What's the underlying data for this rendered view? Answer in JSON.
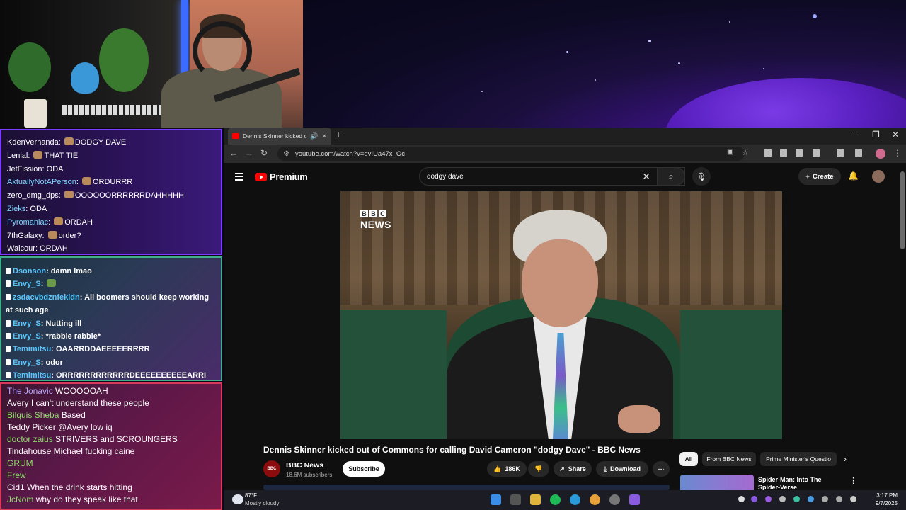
{
  "chat_top": [
    {
      "user": "KdenVernanda",
      "color": "#ffffff",
      "msg": "DODGY DAVE",
      "emote": true
    },
    {
      "user": "Lenial",
      "color": "#ffffff",
      "msg": "THAT TIE",
      "emote": true
    },
    {
      "user": "JetFission",
      "color": "#ffffff",
      "msg": "ODA",
      "emote": false
    },
    {
      "user": "AktuallyNotAPerson",
      "color": "#7fd3ff",
      "msg": "ORDURRR",
      "emote": true
    },
    {
      "user": "zero_dmg_dps",
      "color": "#ffffff",
      "msg": "OOOOOORRRRRRDAHHHHH",
      "emote": true
    },
    {
      "user": "Zieks",
      "color": "#7fd3ff",
      "msg": "ODA",
      "emote": false
    },
    {
      "user": "Pyromaniac",
      "color": "#7fd3ff",
      "msg": "ORDAH",
      "emote": true
    },
    {
      "user": "7thGalaxy",
      "color": "#ffffff",
      "msg": "order?",
      "emote": true
    },
    {
      "user": "Walcour",
      "color": "#ffffff",
      "msg": "ORDAH",
      "emote": false
    }
  ],
  "chat_mid": [
    {
      "user": "Dsonson",
      "msg": "damn lmao"
    },
    {
      "user": "Envy_S",
      "msg": ""
    },
    {
      "user": "zsdacvbdznfekldn",
      "msg": "All boomers should keep working"
    },
    {
      "user": "",
      "msg": "at such age"
    },
    {
      "user": "Envy_S",
      "msg": "Nutting ill"
    },
    {
      "user": "Envy_S",
      "msg": "*rabble rabble*"
    },
    {
      "user": "Temimitsu",
      "msg": "OAARRDDAEEEEERRRR"
    },
    {
      "user": "Envy_S",
      "msg": "odor"
    },
    {
      "user": "Temimitsu",
      "msg": "ORRRRRRRRRRRRDEEEEEEEEEEARRI"
    }
  ],
  "chat_bottom": [
    {
      "user": "The Jonavic",
      "color": "#b8a8ff",
      "msg": "WOOOOOAH"
    },
    {
      "user": "Avery",
      "color": "#ffffff",
      "msg": "I can't understand these people"
    },
    {
      "user": "Bilquis Sheba",
      "color": "#8fdc6a",
      "msg": "Based"
    },
    {
      "user": "Teddy Picker",
      "color": "#ffffff",
      "msg": "@Avery low iq"
    },
    {
      "user": "doctor zaius",
      "color": "#8fdc6a",
      "msg": "STRIVERS and SCROUNGERS"
    },
    {
      "user": "Tindahouse",
      "color": "#ffffff",
      "msg": "Michael fucking caine"
    },
    {
      "user": "GRUM",
      "color": "#8fdc6a",
      "msg": ""
    },
    {
      "user": "Frew",
      "color": "#8fdc6a",
      "msg": ""
    },
    {
      "user": "Cid1",
      "color": "#ffffff",
      "msg": "When the drink starts hitting"
    },
    {
      "user": "JcNom",
      "color": "#8fdc6a",
      "msg": "why do they speak like that"
    }
  ],
  "browser": {
    "tab_title": "Dennis Skinner kicked out of",
    "url": "youtube.com/watch?v=qvIUa47x_Oc"
  },
  "youtube": {
    "brand": "Premium",
    "search_value": "dodgy dave",
    "create_label": "Create",
    "video_title": "Dennis Skinner kicked out of Commons for calling David Cameron \"dodgy Dave\" - BBC News",
    "channel_name": "BBC News",
    "subscribers": "18.6M subscribers",
    "subscribe_label": "Subscribe",
    "likes": "186K",
    "share_label": "Share",
    "download_label": "Download",
    "watermark_news": "NEWS",
    "chips": [
      "All",
      "From BBC News",
      "Prime Minister's Questio"
    ],
    "rec_title": "Spider-Man: Into The Spider-Verse"
  },
  "taskbar": {
    "temp": "87°F",
    "weather": "Mostly cloudy",
    "time": "3:17 PM",
    "date": "9/7/2025"
  },
  "colors": {
    "chat_top_border": "#7b3cff",
    "chat_mid_border": "#3fb08a",
    "chat_bottom_border": "#d83a5c",
    "yt_red": "#ff0000"
  }
}
